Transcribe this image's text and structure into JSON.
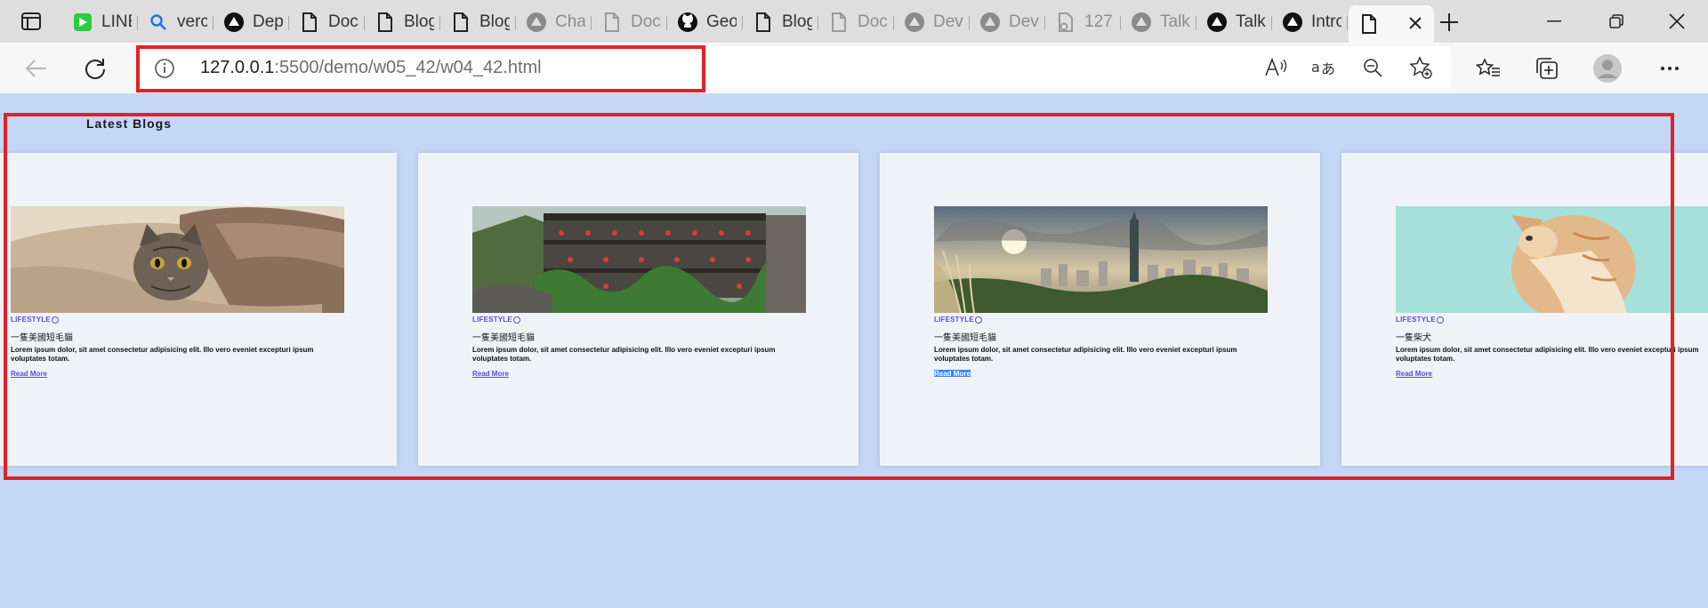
{
  "browser": {
    "tabs": [
      {
        "title": "LINE",
        "icon": "line-icon",
        "dim": false
      },
      {
        "title": "vercel",
        "icon": "search-icon",
        "dim": false
      },
      {
        "title": "Deploy",
        "icon": "vercel-icon",
        "dim": false
      },
      {
        "title": "Docs",
        "icon": "page-icon",
        "dim": false
      },
      {
        "title": "Blog",
        "icon": "page-icon",
        "dim": false
      },
      {
        "title": "Blog",
        "icon": "page-icon",
        "dim": false
      },
      {
        "title": "Chat",
        "icon": "vercel-gray-icon",
        "dim": true
      },
      {
        "title": "Docs",
        "icon": "page-gray-icon",
        "dim": true
      },
      {
        "title": "GeoJ",
        "icon": "github-icon",
        "dim": false
      },
      {
        "title": "Blog",
        "icon": "page-icon",
        "dim": false
      },
      {
        "title": "Docs",
        "icon": "page-gray-icon",
        "dim": true
      },
      {
        "title": "Dev",
        "icon": "vercel-gray-icon",
        "dim": true
      },
      {
        "title": "Dev",
        "icon": "vercel-gray-icon",
        "dim": true
      },
      {
        "title": "127",
        "icon": "page-error-icon",
        "dim": true
      },
      {
        "title": "Talk",
        "icon": "vercel-gray-icon",
        "dim": true
      },
      {
        "title": "Talk",
        "icon": "vercel-icon",
        "dim": false
      },
      {
        "title": "Intro",
        "icon": "vercel-icon",
        "dim": false
      }
    ],
    "active_tab_icon": "page-icon",
    "url_host": "127.0.0.1",
    "url_path": ":5500/demo/w05_42/w04_42.html"
  },
  "page": {
    "section_title": "Latest Blogs",
    "cards": [
      {
        "image": "cat-under-blanket",
        "category": "LIFESTYLE",
        "title": "一隻美國短毛貓",
        "description": "Lorem ipsum dolor, sit amet consectetur adipisicing elit. Illo vero eveniet excepturi ipsum voluptates totam.",
        "link": "Read More",
        "selected": false
      },
      {
        "image": "jiufen-teahouse",
        "category": "LIFESTYLE",
        "title": "一隻美國短毛貓",
        "description": "Lorem ipsum dolor, sit amet consectetur adipisicing elit. Illo vero eveniet excepturi ipsum voluptates totam.",
        "link": "Read More",
        "selected": false
      },
      {
        "image": "taipei-skyline",
        "category": "LIFESTYLE",
        "title": "一隻美國短毛貓",
        "description": "Lorem ipsum dolor, sit amet consectetur adipisicing elit. Illo vero eveniet excepturi ipsum voluptates totam.",
        "link": "Read More",
        "selected": true
      },
      {
        "image": "kitten-on-teal",
        "category": "LIFESTYLE",
        "title": "一隻柴犬",
        "description": "Lorem ipsum dolor, sit amet consectetur adipisicing elit. Illo vero eveniet excepturi ipsum voluptates totam.",
        "link": "Read More",
        "selected": false
      }
    ]
  },
  "colors": {
    "accent": "#5b4ae0",
    "highlight": "#e32128",
    "page_bg": "#c4d7f6",
    "card_bg": "#eff3f7"
  }
}
